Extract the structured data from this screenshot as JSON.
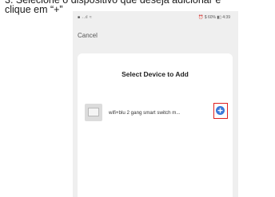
{
  "instruction": "3. Selecione o dispositivo que deseja adicionar e\nclique em “+”",
  "status_bar": {
    "left": "■ ˖.ıl ≈",
    "right": "⏰ $ 60% ▮▯ 4:39"
  },
  "nav": {
    "cancel": "Cancel"
  },
  "dialog": {
    "title": "Select Device to Add",
    "devices": [
      {
        "name": "wifi+blu 2 gang smart switch m...",
        "add_icon": "plus-circle-icon"
      }
    ]
  },
  "colors": {
    "accent": "#3a78d8",
    "highlight": "#e02020"
  }
}
